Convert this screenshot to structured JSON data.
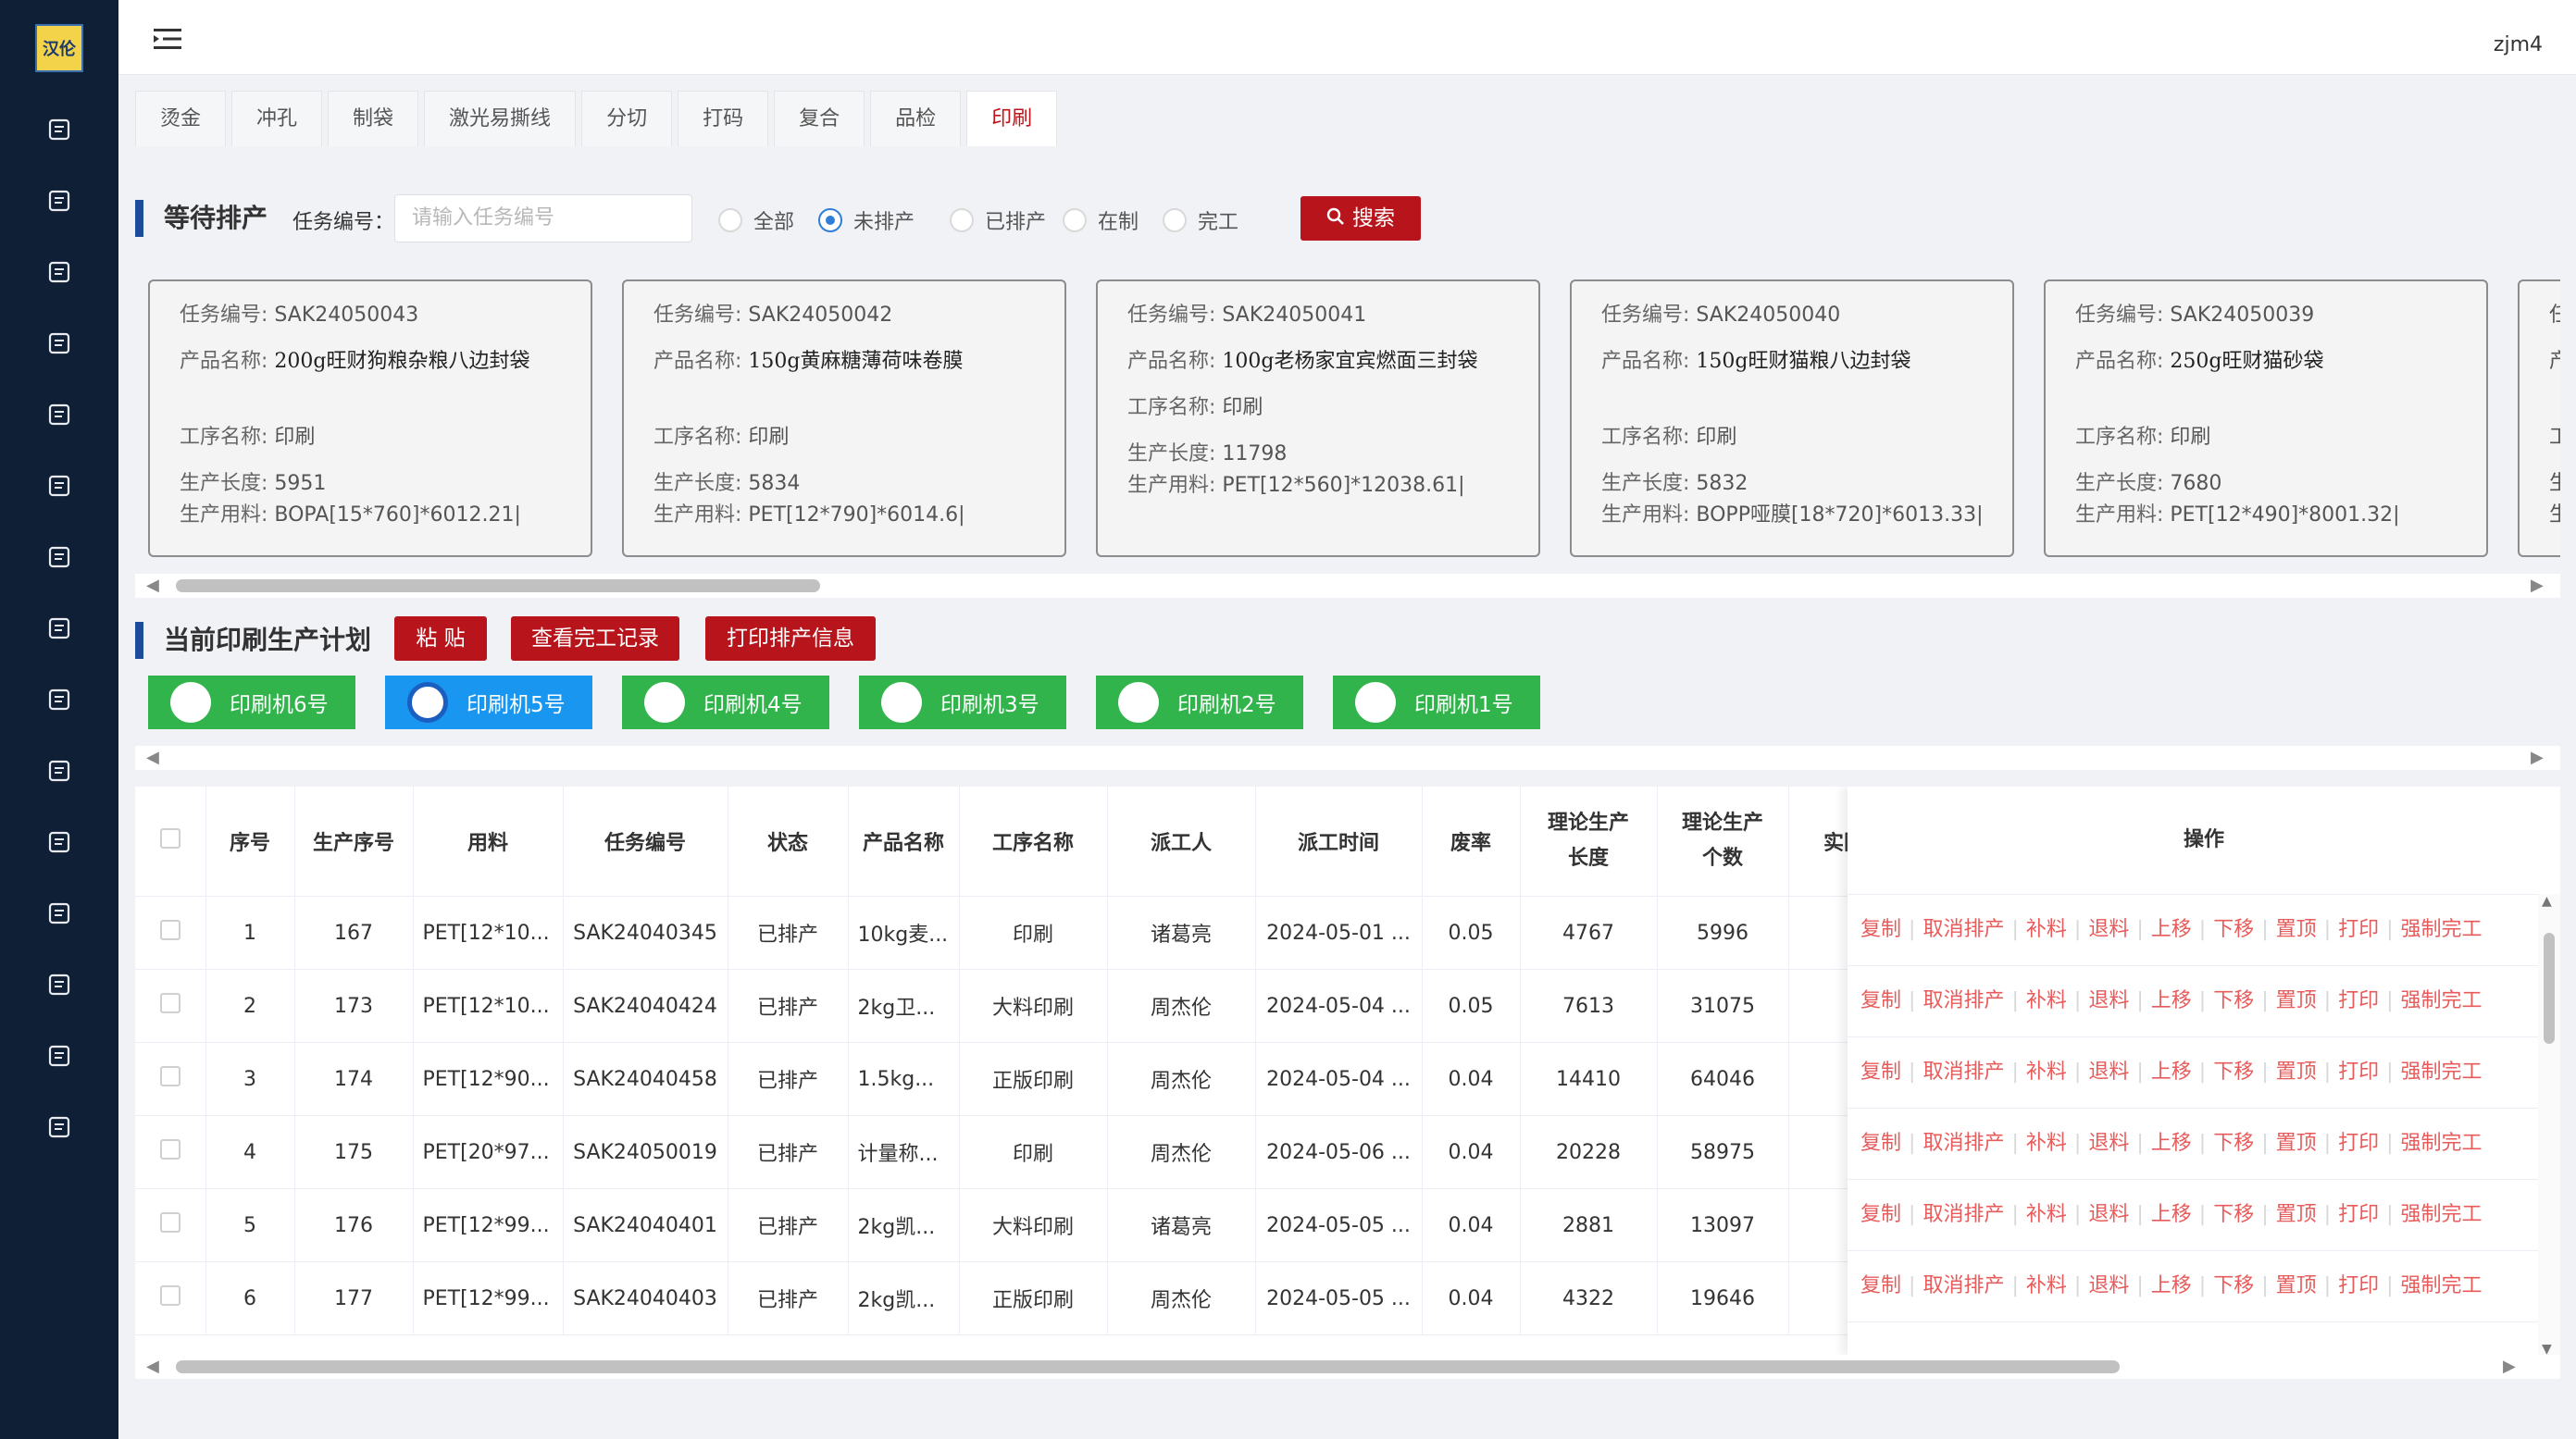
{
  "app": {
    "logo_text": "汉伦",
    "user": "zjm4"
  },
  "sidebar_icons": [
    "report-icon",
    "box-icon",
    "order-icon",
    "doc-icon",
    "calendar-icon",
    "clipboard-icon",
    "task-icon",
    "chart-icon",
    "media-icon",
    "package-icon",
    "list-icon",
    "form-icon",
    "warehouse-icon",
    "device-icon",
    "shield-icon"
  ],
  "tabs": [
    "烫金",
    "冲孔",
    "制袋",
    "激光易撕线",
    "分切",
    "打码",
    "复合",
    "品检",
    "印刷"
  ],
  "active_tab": "印刷",
  "waiting": {
    "title": "等待排产",
    "task_label": "任务编号：",
    "task_placeholder": "请输入任务编号",
    "radios": [
      "全部",
      "未排产",
      "已排产",
      "在制",
      "完工"
    ],
    "selected_radio": "未排产",
    "search_label": "搜索"
  },
  "card_labels": {
    "task": "任务编号:",
    "product": "产品名称:",
    "process": "工序名称:",
    "length": "生产长度:",
    "material": "生产用料:"
  },
  "cards": [
    {
      "task": "SAK24050043",
      "product": "200g旺财狗粮杂粮八边封袋",
      "process": "印刷",
      "length": "5951",
      "material": "BOPA[15*760]*6012.21|"
    },
    {
      "task": "SAK24050042",
      "product": "150g黄麻糖薄荷味卷膜",
      "process": "印刷",
      "length": "5834",
      "material": "PET[12*790]*6014.6|"
    },
    {
      "task": "SAK24050041",
      "product": "100g老杨家宜宾燃面三封袋",
      "process": "印刷",
      "length": "11798",
      "material": "PET[12*560]*12038.61|"
    },
    {
      "task": "SAK24050040",
      "product": "150g旺财猫粮八边封袋",
      "process": "印刷",
      "length": "5832",
      "material": "BOPP哑膜[18*720]*6013.33|"
    },
    {
      "task": "SAK24050039",
      "product": "250g旺财猫砂袋",
      "process": "印刷",
      "length": "7680",
      "material": "PET[12*490]*8001.32|"
    }
  ],
  "partial_card_fragments": [
    "任",
    "产",
    "",
    "工",
    "生",
    "生"
  ],
  "plan": {
    "title": "当前印刷生产计划",
    "buttons": [
      "粘 贴",
      "查看完工记录",
      "打印排产信息"
    ],
    "machines": [
      "印刷机6号",
      "印刷机5号",
      "印刷机4号",
      "印刷机3号",
      "印刷机2号",
      "印刷机1号"
    ],
    "selected_machine": "印刷机5号"
  },
  "table": {
    "headers": [
      "",
      "序号",
      "生产序号",
      "用料",
      "任务编号",
      "状态",
      "产品名称",
      "工序名称",
      "派工人",
      "派工时间",
      "废率",
      "理论生产长度",
      "理论生产个数",
      "实际"
    ],
    "ops_header": "操作",
    "ops": [
      "复制",
      "取消排产",
      "补料",
      "退料",
      "上移",
      "下移",
      "置顶",
      "打印",
      "强制完工"
    ],
    "rows": [
      {
        "seq": "1",
        "prod_seq": "167",
        "material": "PET[12*10...",
        "task": "SAK24040345",
        "status": "已排产",
        "product": "10kg麦...",
        "process": "印刷",
        "worker": "诸葛亮",
        "time": "2024-05-01 ...",
        "waste": "0.05",
        "length": "4767",
        "count": "5996"
      },
      {
        "seq": "2",
        "prod_seq": "173",
        "material": "PET[12*10...",
        "task": "SAK24040424",
        "status": "已排产",
        "product": "2kg卫...",
        "process": "大料印刷",
        "worker": "周杰伦",
        "time": "2024-05-04 ...",
        "waste": "0.05",
        "length": "7613",
        "count": "31075"
      },
      {
        "seq": "3",
        "prod_seq": "174",
        "material": "PET[12*90...",
        "task": "SAK24040458",
        "status": "已排产",
        "product": "1.5kg...",
        "process": "正版印刷",
        "worker": "周杰伦",
        "time": "2024-05-04 ...",
        "waste": "0.04",
        "length": "14410",
        "count": "64046"
      },
      {
        "seq": "4",
        "prod_seq": "175",
        "material": "PET[20*97...",
        "task": "SAK24050019",
        "status": "已排产",
        "product": "计量称...",
        "process": "印刷",
        "worker": "周杰伦",
        "time": "2024-05-06 ...",
        "waste": "0.04",
        "length": "20228",
        "count": "58975"
      },
      {
        "seq": "5",
        "prod_seq": "176",
        "material": "PET[12*99...",
        "task": "SAK24040401",
        "status": "已排产",
        "product": "2kg凯...",
        "process": "大料印刷",
        "worker": "诸葛亮",
        "time": "2024-05-05 ...",
        "waste": "0.04",
        "length": "2881",
        "count": "13097"
      },
      {
        "seq": "6",
        "prod_seq": "177",
        "material": "PET[12*99...",
        "task": "SAK24040403",
        "status": "已排产",
        "product": "2kg凯...",
        "process": "正版印刷",
        "worker": "周杰伦",
        "time": "2024-05-05 ...",
        "waste": "0.04",
        "length": "4322",
        "count": "19646"
      }
    ]
  },
  "colors": {
    "sidebar": "#0f1f35",
    "accent_red": "#b7141b",
    "machine_green": "#31b44b",
    "machine_selected": "#1896f0",
    "op_link": "#e85b5b",
    "title_bar": "#1d4c9a"
  }
}
